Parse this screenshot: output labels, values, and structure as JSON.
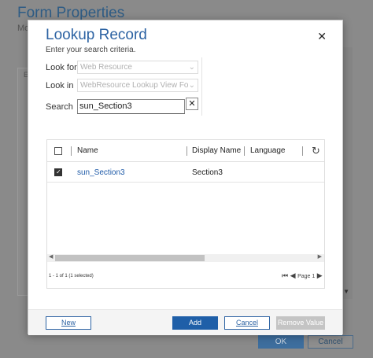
{
  "background": {
    "title": "Form Properties",
    "subtitle": "Mo",
    "panel_letter": "E",
    "ok_label": "OK",
    "cancel_label": "Cancel"
  },
  "dialog": {
    "title": "Lookup Record",
    "subtitle": "Enter your search criteria.",
    "close_icon": "close-icon"
  },
  "fields": {
    "look_for_label": "Look for",
    "look_for_value": "Web Resource",
    "look_in_label": "Look in",
    "look_in_value": "WebResource Lookup View Fo",
    "search_label": "Search",
    "search_value": "sun_Section3",
    "clear_glyph": "✕"
  },
  "grid": {
    "columns": [
      "Name",
      "Display Name",
      "Language"
    ],
    "rows": [
      {
        "name": "sun_Section3",
        "display_name": "Section3",
        "language": "",
        "checked": true
      }
    ],
    "status": "1 - 1 of 1 (1 selected)",
    "page_label": "Page 1"
  },
  "footer": {
    "new_label": "New",
    "add_label": "Add",
    "cancel_label": "Cancel",
    "remove_label": "Remove Value"
  },
  "colors": {
    "accent": "#1f5fa8",
    "title": "#2d63a3",
    "disabled": "#c4c4c4"
  }
}
